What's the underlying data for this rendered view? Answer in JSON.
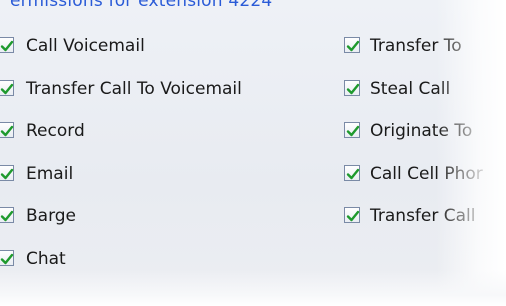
{
  "section": {
    "title": "ermissions for extension 4224"
  },
  "left_column": [
    {
      "label": "Call Voicemail",
      "checked": true
    },
    {
      "label": "Transfer Call To Voicemail",
      "checked": true
    },
    {
      "label": "Record",
      "checked": true
    },
    {
      "label": "Email",
      "checked": true
    },
    {
      "label": "Barge",
      "checked": true
    },
    {
      "label": "Chat",
      "checked": true
    }
  ],
  "right_column": [
    {
      "label": "Transfer To",
      "checked": true
    },
    {
      "label": "Steal Call",
      "checked": true
    },
    {
      "label": "Originate To",
      "checked": true
    },
    {
      "label": "Call Cell Phor",
      "checked": true
    },
    {
      "label": "Transfer Call",
      "checked": true
    }
  ],
  "colors": {
    "title": "#2a5bd7",
    "check": "#1f9a2e",
    "checkbox_border": "#7a8aa6"
  }
}
